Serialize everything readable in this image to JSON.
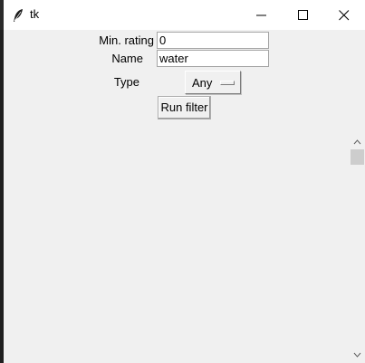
{
  "window": {
    "title": "tk",
    "app_icon": "feather-icon"
  },
  "titlebar_buttons": {
    "minimize_icon": "minimize-icon",
    "maximize_icon": "maximize-icon",
    "close_icon": "close-icon"
  },
  "form": {
    "min_rating_label": "Min. rating",
    "min_rating_value": "0",
    "name_label": "Name",
    "name_value": "water",
    "type_label": "Type",
    "type_selected": "Any",
    "run_button_label": "Run filter"
  },
  "scrollbar": {
    "up_icon": "chevron-up-icon",
    "down_icon": "chevron-down-icon"
  },
  "colors": {
    "window_bg": "#f0f0f0",
    "titlebar_bg": "#ffffff"
  }
}
